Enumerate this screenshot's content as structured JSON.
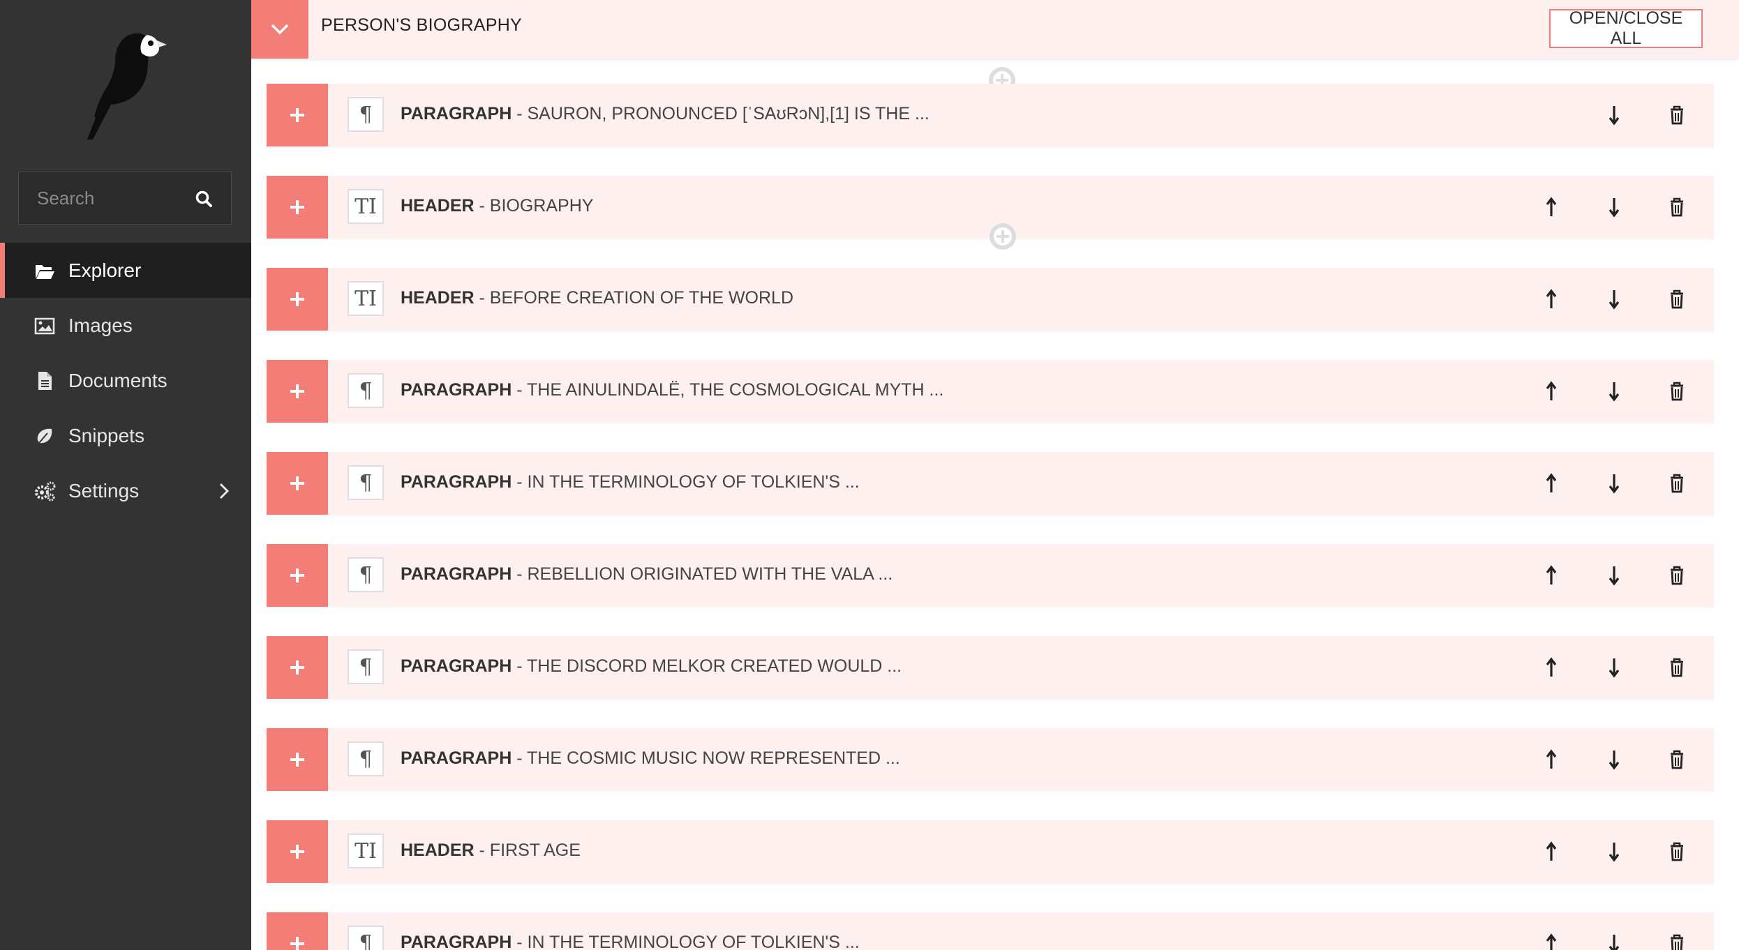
{
  "sidebar": {
    "search_placeholder": "Search",
    "items": [
      {
        "label": "Explorer",
        "icon": "folder-open-icon",
        "active": true
      },
      {
        "label": "Images",
        "icon": "image-icon"
      },
      {
        "label": "Documents",
        "icon": "document-icon"
      },
      {
        "label": "Snippets",
        "icon": "snippet-icon"
      },
      {
        "label": "Settings",
        "icon": "cogs-icon",
        "has_submenu": true
      }
    ]
  },
  "panel": {
    "title": "PERSON'S BIOGRAPHY",
    "open_close_label": "OPEN/CLOSE ALL"
  },
  "blocks": [
    {
      "kind": "PARAGRAPH",
      "text": " - SAURON, PRONOUNCED [ˈSAʊRɔN],[1] IS THE ...",
      "icon": "paragraph-icon",
      "type_glyph": "¶"
    },
    {
      "kind": "HEADER",
      "text": " - BIOGRAPHY",
      "icon": "header-icon",
      "type_glyph": "TI"
    },
    {
      "kind": "HEADER",
      "text": " - BEFORE CREATION OF THE WORLD",
      "icon": "header-icon",
      "type_glyph": "TI"
    },
    {
      "kind": "PARAGRAPH",
      "text": " - THE AINULINDALË, THE COSMOLOGICAL MYTH ...",
      "icon": "paragraph-icon",
      "type_glyph": "¶"
    },
    {
      "kind": "PARAGRAPH",
      "text": " - IN THE TERMINOLOGY OF TOLKIEN'S ...",
      "icon": "paragraph-icon",
      "type_glyph": "¶"
    },
    {
      "kind": "PARAGRAPH",
      "text": " - REBELLION ORIGINATED WITH THE VALA ...",
      "icon": "paragraph-icon",
      "type_glyph": "¶"
    },
    {
      "kind": "PARAGRAPH",
      "text": " - THE DISCORD MELKOR CREATED WOULD ...",
      "icon": "paragraph-icon",
      "type_glyph": "¶"
    },
    {
      "kind": "PARAGRAPH",
      "text": " - THE COSMIC MUSIC NOW REPRESENTED ...",
      "icon": "paragraph-icon",
      "type_glyph": "¶"
    },
    {
      "kind": "HEADER",
      "text": " - FIRST AGE",
      "icon": "header-icon",
      "type_glyph": "TI"
    },
    {
      "kind": "PARAGRAPH",
      "text": " - IN THE TERMINOLOGY OF TOLKIEN'S ...",
      "icon": "paragraph-icon",
      "type_glyph": "¶"
    }
  ],
  "colors": {
    "accent": "#f37e77",
    "sidebar_bg": "#333333",
    "block_bg": "#fdf0ef"
  }
}
